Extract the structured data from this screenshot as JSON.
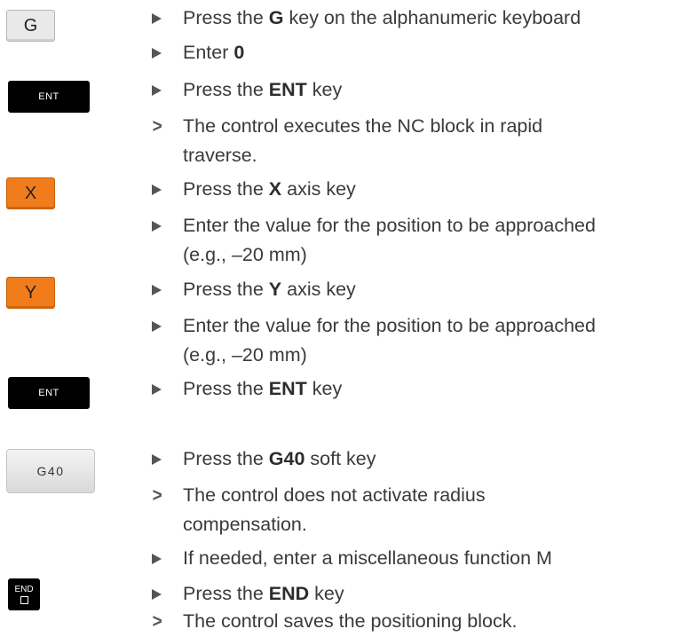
{
  "keys": {
    "g": "G",
    "ent1": "ENT",
    "x": "X",
    "y": "Y",
    "ent2": "ENT",
    "g40": "G40",
    "end": "END"
  },
  "steps": [
    {
      "pre": "Press the ",
      "bold": "G",
      "post": " key on the alphanumeric keyboard"
    },
    {
      "pre": "Enter ",
      "bold": "0",
      "post": ""
    },
    {
      "pre": "Press the ",
      "bold": "ENT",
      "post": " key"
    },
    {
      "line1": "The control executes the NC block in rapid",
      "line2": "traverse."
    },
    {
      "pre": "Press the ",
      "bold": "X",
      "post": " axis key"
    },
    {
      "line1": "Enter the value for the position to be approached",
      "line2": "(e.g., –20 mm)"
    },
    {
      "pre": "Press the ",
      "bold": "Y",
      "post": " axis key"
    },
    {
      "line1": "Enter the value for the position to be approached",
      "line2": "(e.g., –20 mm)"
    },
    {
      "pre": "Press the ",
      "bold": "ENT",
      "post": " key"
    },
    {
      "pre": "Press the ",
      "bold": "G40",
      "post": " soft key"
    },
    {
      "line1": "The control does not activate radius",
      "line2": "compensation."
    },
    {
      "text": "If needed, enter a miscellaneous function M"
    },
    {
      "pre": "Press the ",
      "bold": "END",
      "post": " key"
    },
    {
      "text": "The control saves the positioning block."
    }
  ],
  "colors": {
    "axis_key": "#f07c1c",
    "ent_key": "#000000",
    "g_key": "#e9e9e9"
  }
}
